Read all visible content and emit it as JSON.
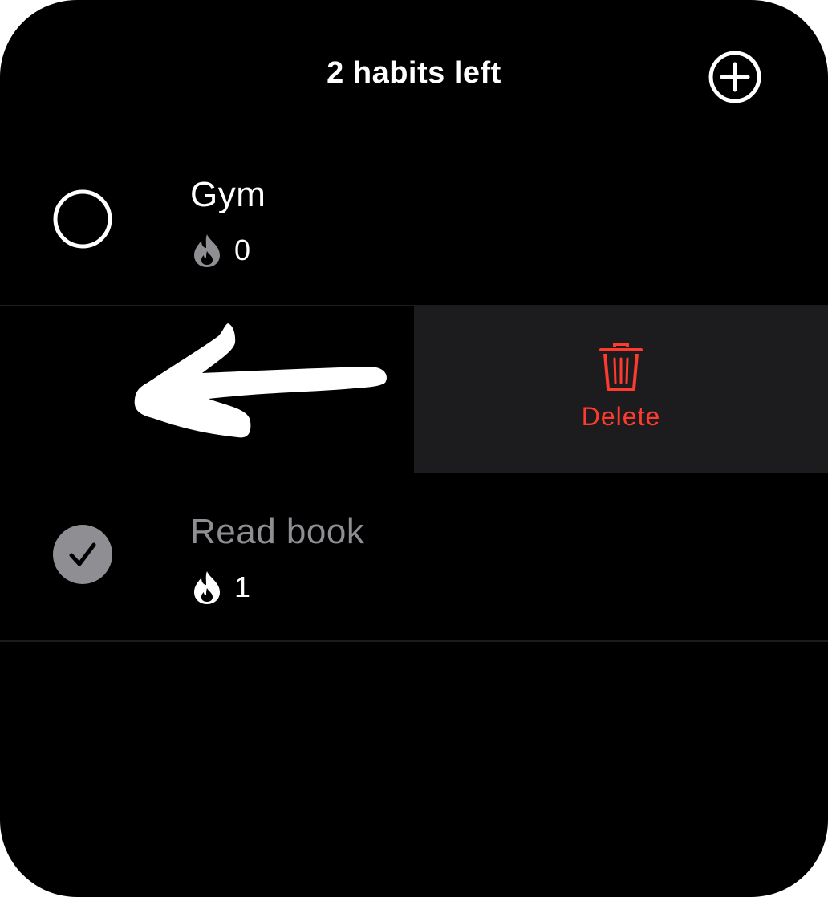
{
  "header": {
    "title": "2 habits left",
    "add_icon": "plus-circle-icon"
  },
  "habits": [
    {
      "name": "Gym",
      "completed": false,
      "streak_icon": "flame-icon",
      "streak": "0"
    },
    {
      "name": "Read book",
      "completed": true,
      "streak_icon": "flame-icon",
      "streak": "1"
    }
  ],
  "swipe_row": {
    "gesture_icon": "left-arrow-icon",
    "delete_icon": "trash-icon",
    "delete_label": "Delete"
  },
  "colors": {
    "background": "#000000",
    "delete_red": "#ff3b30",
    "action_bg": "#1c1c1e",
    "completed_gray": "#8e8e93",
    "divider": "#1c1c1e"
  }
}
